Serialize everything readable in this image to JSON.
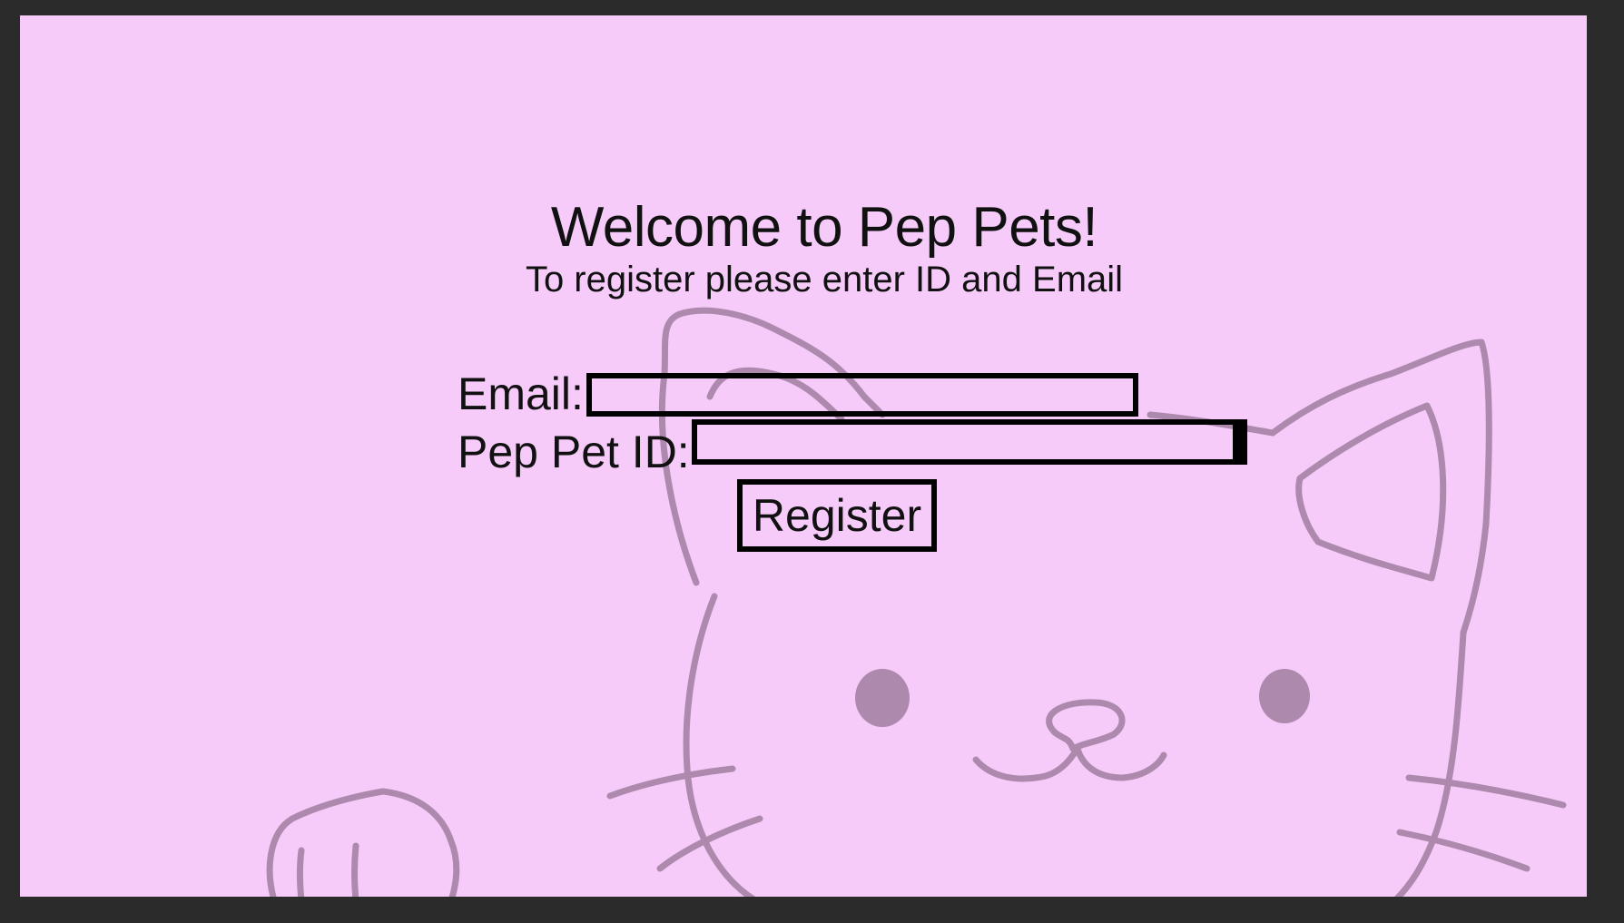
{
  "page": {
    "title": "Welcome to Pep Pets!",
    "subtitle": "To register please enter ID and Email"
  },
  "form": {
    "email_label": "Email:",
    "email_value": "",
    "pet_id_label": "Pep Pet ID:",
    "pet_id_value": "",
    "register_label": "Register"
  },
  "colors": {
    "background": "#f6cbf9",
    "frame": "#2b2b2b",
    "cat_outline": "#ad89ad",
    "text": "#111111"
  },
  "decor": {
    "background_art": "cat-face-sketch"
  }
}
